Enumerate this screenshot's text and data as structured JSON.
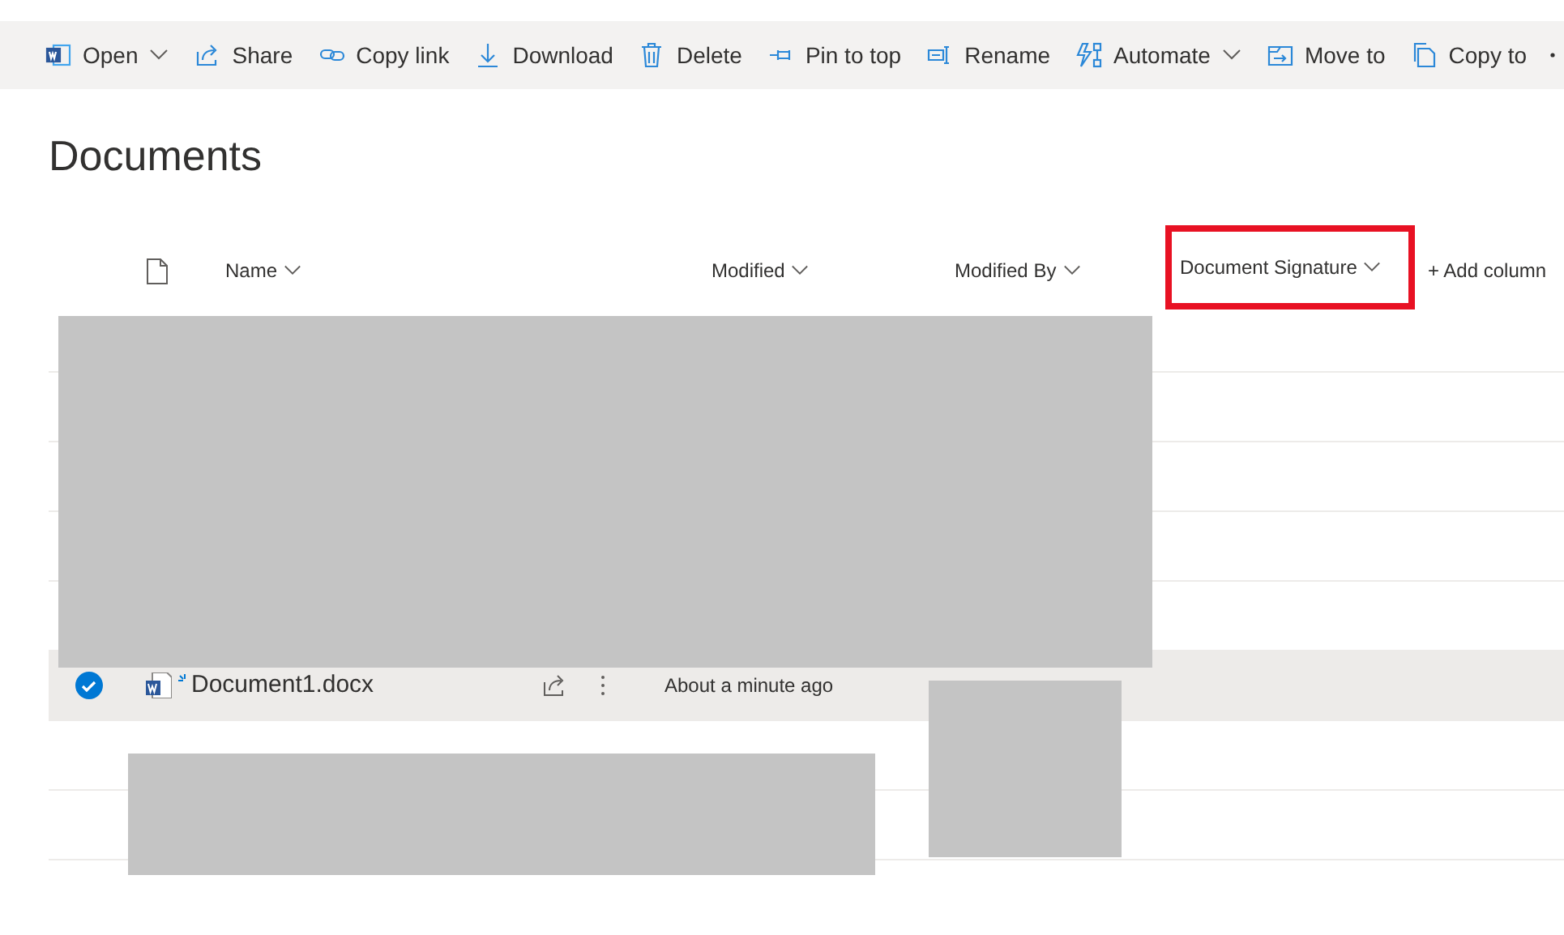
{
  "toolbar": [
    {
      "label": "Open",
      "has_menu": true
    },
    {
      "label": "Share",
      "has_menu": false
    },
    {
      "label": "Copy link",
      "has_menu": false
    },
    {
      "label": "Download",
      "has_menu": false
    },
    {
      "label": "Delete",
      "has_menu": false
    },
    {
      "label": "Pin to top",
      "has_menu": false
    },
    {
      "label": "Rename",
      "has_menu": false
    },
    {
      "label": "Automate",
      "has_menu": true
    },
    {
      "label": "Move to",
      "has_menu": false
    },
    {
      "label": "Copy to",
      "has_menu": false
    }
  ],
  "title": "Documents",
  "columns": [
    {
      "label": "Name",
      "highlighted": false
    },
    {
      "label": "Modified",
      "highlighted": false
    },
    {
      "label": "Modified By",
      "highlighted": false
    },
    {
      "label": "Document Signature",
      "highlighted": true
    }
  ],
  "add_column": "+ Add column",
  "rows": [
    {
      "name": "Document1.docx",
      "modified": "About a minute ago",
      "selected": true,
      "new": true
    }
  ]
}
